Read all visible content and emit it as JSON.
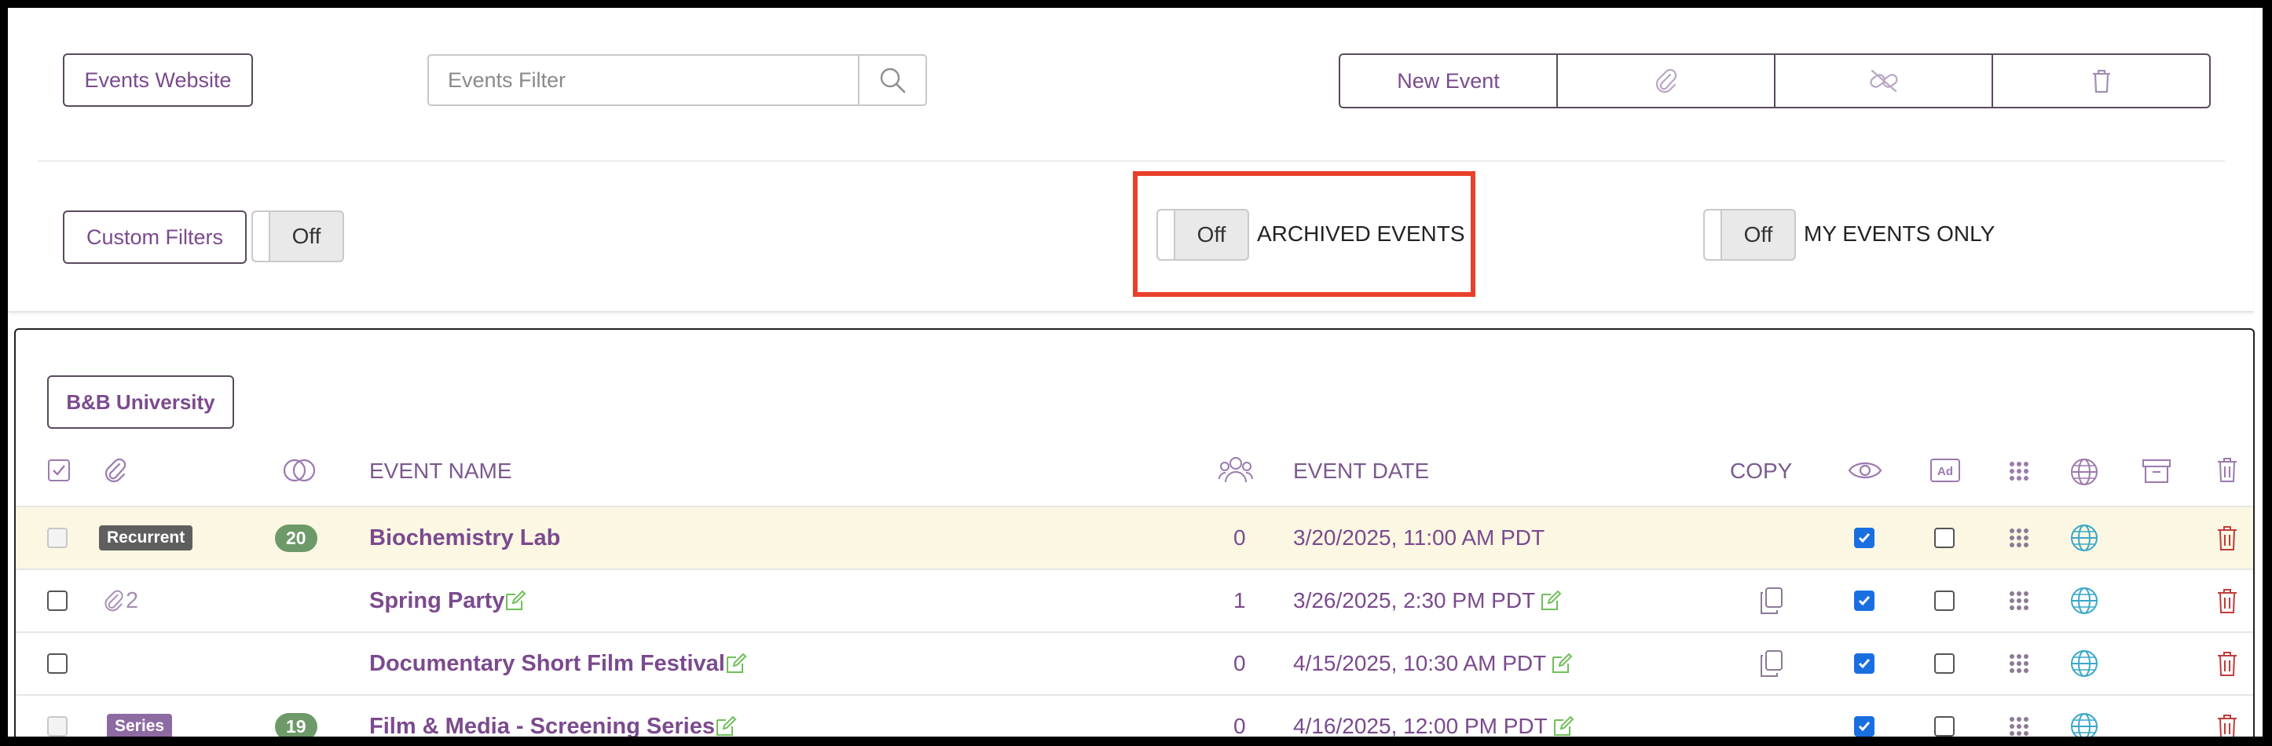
{
  "toolbar": {
    "events_website_label": "Events Website",
    "filter_placeholder": "Events Filter",
    "new_event_label": "New Event"
  },
  "filters": {
    "custom_filters_label": "Custom Filters",
    "custom_filters_state": "Off",
    "archived_state": "Off",
    "archived_label": "ARCHIVED EVENTS",
    "my_events_state": "Off",
    "my_events_label": "MY EVENTS ONLY"
  },
  "table": {
    "org_label": "B&B University",
    "headers": {
      "event_name": "EVENT NAME",
      "event_date": "EVENT DATE",
      "copy": "COPY"
    },
    "rows": [
      {
        "tag": "Recurrent",
        "count": "20",
        "attachments": "",
        "name": "Biochemistry Lab",
        "attendees": "0",
        "date": "3/20/2025, 11:00 AM PDT",
        "visible": true,
        "ad": false
      },
      {
        "tag": "",
        "count": "",
        "attachments": "2",
        "name": "Spring Party",
        "attendees": "1",
        "date": "3/26/2025, 2:30 PM PDT",
        "visible": true,
        "ad": false
      },
      {
        "tag": "",
        "count": "",
        "attachments": "",
        "name": "Documentary Short Film Festival",
        "attendees": "0",
        "date": "4/15/2025, 10:30 AM PDT",
        "visible": true,
        "ad": false
      },
      {
        "tag": "Series",
        "count": "19",
        "attachments": "",
        "name": "Film & Media - Screening Series",
        "attendees": "0",
        "date": "4/16/2025, 12:00 PM PDT",
        "visible": true,
        "ad": false
      }
    ]
  },
  "colors": {
    "accent": "#7b4a8e",
    "highlight": "#e8402a",
    "checkbox": "#1a6fe0",
    "globe": "#3aa8c8",
    "trash": "#c23b3b",
    "edit": "#6fbf5a"
  }
}
